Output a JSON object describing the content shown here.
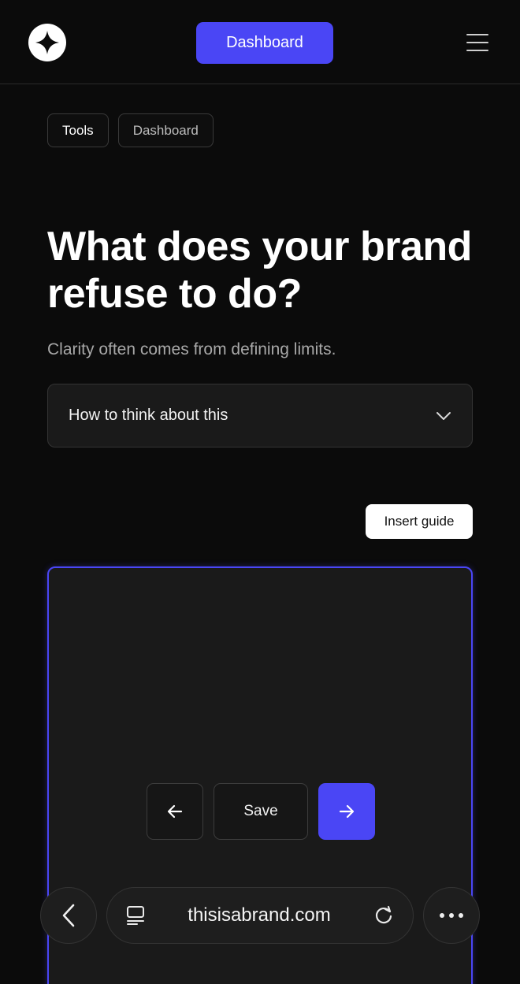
{
  "header": {
    "logo_icon": "sparkle-star-icon",
    "dashboard_label": "Dashboard",
    "menu_icon": "hamburger-menu-icon"
  },
  "breadcrumb": {
    "items": [
      {
        "label": "Tools",
        "state": "active"
      },
      {
        "label": "Dashboard",
        "state": "inactive"
      }
    ]
  },
  "main": {
    "title": "What does your brand refuse to do?",
    "subtitle": "Clarity often comes from defining limits.",
    "accordion": {
      "label": "How to think about this",
      "icon": "chevron-down-icon"
    },
    "insert_guide_label": "Insert guide",
    "editor": {
      "value": "",
      "placeholder": ""
    },
    "controls": {
      "prev_icon": "arrow-left-icon",
      "save_label": "Save",
      "next_icon": "arrow-right-icon"
    }
  },
  "browser_bar": {
    "back_icon": "chevron-left-icon",
    "reader_icon": "reader-view-icon",
    "url": "thisisabrand.com",
    "reload_icon": "reload-icon",
    "more_icon": "more-dots-icon"
  },
  "colors": {
    "background": "#0b0b0b",
    "accent": "#4a46f5",
    "panel": "#1a1a1a"
  }
}
